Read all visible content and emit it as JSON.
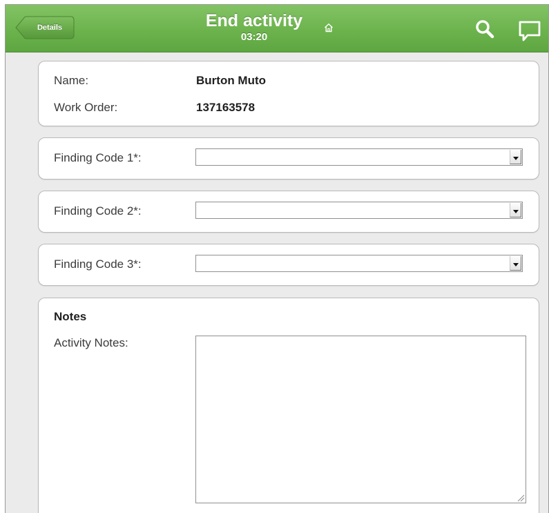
{
  "header": {
    "back_label": "Details",
    "title": "End activity",
    "timer": "03:20",
    "accent_color": "#6cb34d"
  },
  "icons": {
    "home": "home-icon",
    "search": "search-icon",
    "chat": "chat-icon"
  },
  "info": {
    "name_label": "Name:",
    "name_value": "Burton Muto",
    "work_order_label": "Work Order:",
    "work_order_value": "137163578"
  },
  "findings": [
    {
      "label": "Finding Code 1*:",
      "value": ""
    },
    {
      "label": "Finding Code 2*:",
      "value": ""
    },
    {
      "label": "Finding Code 3*:",
      "value": ""
    }
  ],
  "notes": {
    "heading": "Notes",
    "activity_label": "Activity Notes:",
    "activity_value": ""
  }
}
